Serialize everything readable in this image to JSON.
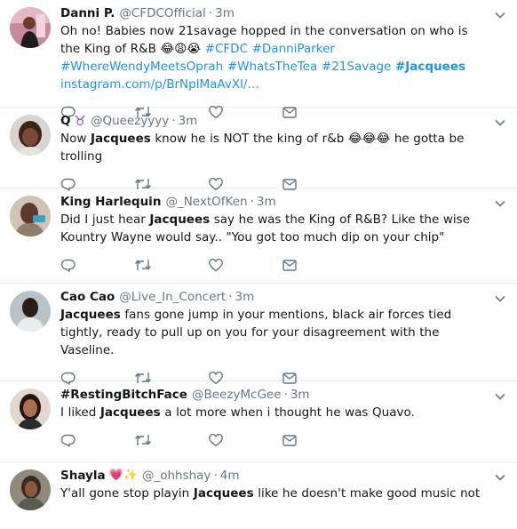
{
  "tweets": [
    {
      "name": "Danni P.",
      "badge": "",
      "handle": "@CFDCOfficial",
      "time": "3m",
      "segments": [
        {
          "t": "Oh no! Babies now 21savage hopped in the conversation on who is the King of R&B ",
          "k": "txt"
        },
        {
          "t": "😂",
          "k": "emo"
        },
        {
          "t": "😩",
          "k": "emo"
        },
        {
          "t": "😭",
          "k": "emo"
        },
        {
          "t": " ",
          "k": "txt"
        },
        {
          "t": "#CFDC",
          "k": "hash"
        },
        {
          "t": " ",
          "k": "txt"
        },
        {
          "t": "#DanniParker",
          "k": "hash"
        },
        {
          "t": " ",
          "k": "txt"
        },
        {
          "t": "#WhereWendyMeetsOprah",
          "k": "hash"
        },
        {
          "t": " ",
          "k": "txt"
        },
        {
          "t": "#WhatsTheTea",
          "k": "hash"
        },
        {
          "t": " ",
          "k": "txt"
        },
        {
          "t": "#21Savage",
          "k": "hash"
        },
        {
          "t": " ",
          "k": "txt"
        },
        {
          "t": "#Jacquees",
          "k": "hashbold"
        },
        {
          "t": " ",
          "k": "txt"
        },
        {
          "t": "instagram.com/p/BrNplMaAvXl/…",
          "k": "link"
        }
      ]
    },
    {
      "name": "Q",
      "badge": "♉",
      "handle": "@Queezyyyy",
      "time": "3m",
      "segments": [
        {
          "t": "Now ",
          "k": "txt"
        },
        {
          "t": "Jacquees",
          "k": "bold"
        },
        {
          "t": " know he is NOT the king of r&b ",
          "k": "txt"
        },
        {
          "t": "😂",
          "k": "emo"
        },
        {
          "t": "😂",
          "k": "emo"
        },
        {
          "t": "😂",
          "k": "emo"
        },
        {
          "t": " he gotta be trolling",
          "k": "txt"
        }
      ]
    },
    {
      "name": "King Harlequin",
      "badge": "",
      "handle": "@_NextOfKen",
      "time": "3m",
      "segments": [
        {
          "t": "Did I just hear ",
          "k": "txt"
        },
        {
          "t": "Jacquees",
          "k": "bold"
        },
        {
          "t": " say he was the King of R&B? Like the wise Kountry Wayne would say.. \"You got too much dip on your chip\"",
          "k": "txt"
        }
      ]
    },
    {
      "name": "Cao Cao",
      "badge": "",
      "handle": "@Live_In_Concert",
      "time": "3m",
      "segments": [
        {
          "t": "Jacquees",
          "k": "bold"
        },
        {
          "t": " fans gone jump in your mentions, black air forces tied tightly, ready to pull up on you for your disagreement with the Vaseline.",
          "k": "txt"
        }
      ]
    },
    {
      "name": "#RestingBitchFace",
      "badge": "",
      "handle": "@BeezyMcGee",
      "time": "3m",
      "segments": [
        {
          "t": "I liked ",
          "k": "txt"
        },
        {
          "t": "Jacquees",
          "k": "bold"
        },
        {
          "t": " a lot more when i thought he was Quavo.",
          "k": "txt"
        }
      ]
    },
    {
      "name": "Shayla",
      "badge": "💗✨",
      "handle": "@_ohhshay",
      "time": "4m",
      "segments": [
        {
          "t": "Y'all gone stop playin ",
          "k": "txt"
        },
        {
          "t": "Jacquees",
          "k": "bold"
        },
        {
          "t": " like he doesn't make good music not",
          "k": "txt"
        }
      ]
    }
  ],
  "colors": {
    "link": "#1b95e0",
    "muted": "#657786",
    "text": "#14171a",
    "border": "#e6ecf0",
    "badge_taurus": "#794bc4"
  },
  "icons": [
    "reply-icon",
    "retweet-icon",
    "like-icon",
    "message-icon",
    "chevron-down-icon"
  ]
}
